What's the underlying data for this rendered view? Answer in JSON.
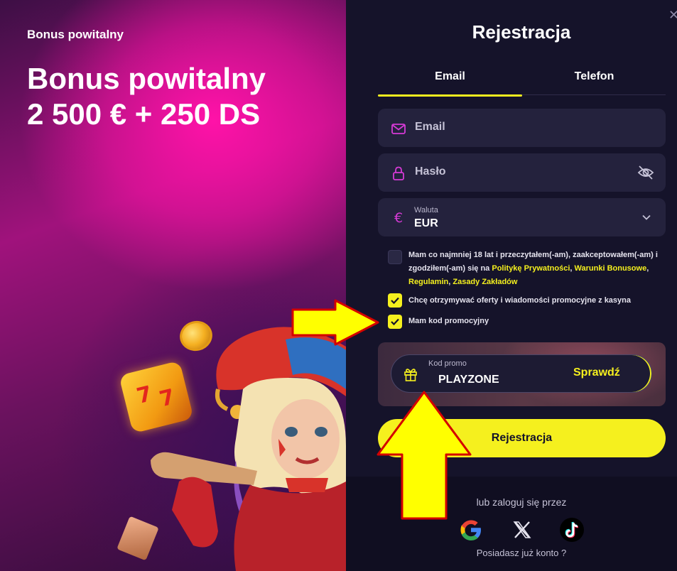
{
  "promo": {
    "kicker": "Bonus powitalny",
    "title_line1": "Bonus powitalny",
    "title_line2": "2 500 € + 250 DS"
  },
  "form": {
    "title": "Rejestracja",
    "close_label": "✕",
    "tabs": [
      {
        "label": "Email",
        "active": true
      },
      {
        "label": "Telefon",
        "active": false
      }
    ],
    "email_placeholder": "Email",
    "password_placeholder": "Hasło",
    "currency": {
      "label": "Waluta",
      "value": "EUR",
      "icon": "€"
    },
    "terms": {
      "checked": false,
      "text_before": "Mam co najmniej 18 lat i przeczytałem(-am), zaakceptowałem(-am) i zgodziłem(-am) się na ",
      "link_privacy": "Politykę Prywatności",
      "sep1": ", ",
      "link_bonus": "Warunki Bonusowe",
      "sep2": ", ",
      "link_rules": "Regulamin",
      "sep3": ", ",
      "link_betting": "Zasady Zakładów"
    },
    "marketing_opt_in": {
      "checked": true,
      "label": "Chcę otrzymywać oferty i wiadomości promocyjne z kasyna"
    },
    "has_promo_code": {
      "checked": true,
      "label": "Mam kod promocyjny"
    },
    "promo_code": {
      "label": "Kod promo",
      "value": "PLAYZONE",
      "check_button": "Sprawdź"
    },
    "submit_label": "Rejestracja"
  },
  "footer": {
    "or_login_with": "lub zaloguj się przez",
    "social": [
      "google-icon",
      "x-icon",
      "tiktok-icon"
    ],
    "have_account": "Posiadasz już konto ?"
  },
  "colors": {
    "accent": "#f5f01e",
    "panel_bg": "#15132a",
    "field_bg": "#24223d",
    "promo_pink": "#ff12a8",
    "icon_magenta": "#d63ad6",
    "annotation_arrow_fill": "#ffff00",
    "annotation_arrow_stroke": "#d40000"
  }
}
